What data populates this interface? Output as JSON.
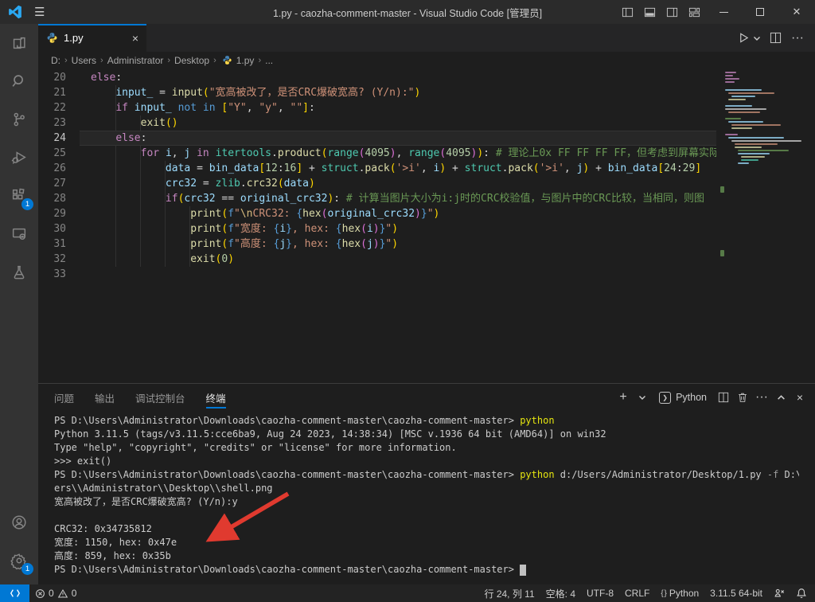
{
  "window": {
    "title": "1.py - caozha-comment-master - Visual Studio Code [管理员]"
  },
  "colors": {
    "accent": "#0078d4",
    "arrow": "#e03a2f",
    "terminal_command": "#e5e510"
  },
  "activity_bar": {
    "extensions_badge": "1",
    "settings_badge": "1"
  },
  "tab": {
    "label": "1.py",
    "close": "×"
  },
  "breadcrumb": {
    "items": [
      "D:",
      "Users",
      "Administrator",
      "Desktop",
      "1.py",
      "..."
    ]
  },
  "editor": {
    "lines": [
      {
        "no": "20",
        "segs": [
          [
            "else",
            "kw"
          ],
          [
            ":",
            "def"
          ]
        ]
      },
      {
        "no": "21",
        "segs": [
          [
            "    ",
            "ws"
          ],
          [
            "input_",
            "var"
          ],
          [
            " ",
            "ws"
          ],
          [
            "=",
            "op"
          ],
          [
            " ",
            "ws"
          ],
          [
            "input",
            "fn"
          ],
          [
            "(",
            "b1"
          ],
          [
            "\"宽高被改了，是否CRC爆破宽高? (Y/n):\"",
            "str"
          ],
          [
            ")",
            "b1"
          ]
        ]
      },
      {
        "no": "22",
        "segs": [
          [
            "    ",
            "ws"
          ],
          [
            "if",
            "kw"
          ],
          [
            " ",
            "ws"
          ],
          [
            "input_",
            "var"
          ],
          [
            " ",
            "ws"
          ],
          [
            "not",
            "kb"
          ],
          [
            " ",
            "ws"
          ],
          [
            "in",
            "kb"
          ],
          [
            " ",
            "ws"
          ],
          [
            "[",
            "b1"
          ],
          [
            "\"Y\"",
            "str"
          ],
          [
            ", ",
            "def"
          ],
          [
            "\"y\"",
            "str"
          ],
          [
            ", ",
            "def"
          ],
          [
            "\"\"",
            "str"
          ],
          [
            "]",
            "b1"
          ],
          [
            ":",
            "def"
          ]
        ]
      },
      {
        "no": "23",
        "segs": [
          [
            "        ",
            "ws"
          ],
          [
            "exit",
            "fn"
          ],
          [
            "(",
            "b1"
          ],
          [
            ")",
            "b1"
          ]
        ]
      },
      {
        "no": "24",
        "current": true,
        "segs": [
          [
            "    ",
            "ws"
          ],
          [
            "else",
            "kw"
          ],
          [
            ":",
            "def"
          ]
        ]
      },
      {
        "no": "25",
        "segs": [
          [
            "        ",
            "ws"
          ],
          [
            "for",
            "kw"
          ],
          [
            " ",
            "ws"
          ],
          [
            "i",
            "var"
          ],
          [
            ", ",
            "def"
          ],
          [
            "j",
            "var"
          ],
          [
            " ",
            "ws"
          ],
          [
            "in",
            "kw"
          ],
          [
            " ",
            "ws"
          ],
          [
            "itertools",
            "cls"
          ],
          [
            ".",
            "def"
          ],
          [
            "product",
            "fn"
          ],
          [
            "(",
            "b1"
          ],
          [
            "range",
            "cls"
          ],
          [
            "(",
            "b2"
          ],
          [
            "4095",
            "num"
          ],
          [
            ")",
            "b2"
          ],
          [
            ", ",
            "def"
          ],
          [
            "range",
            "cls"
          ],
          [
            "(",
            "b2"
          ],
          [
            "4095",
            "num"
          ],
          [
            ")",
            "b2"
          ],
          [
            ")",
            "b1"
          ],
          [
            ":",
            "def"
          ],
          [
            " ",
            "ws"
          ],
          [
            "# 理论上0x FF FF FF FF，但考虑到屏幕实际",
            "com"
          ]
        ]
      },
      {
        "no": "26",
        "segs": [
          [
            "            ",
            "ws"
          ],
          [
            "data",
            "var"
          ],
          [
            " ",
            "ws"
          ],
          [
            "=",
            "op"
          ],
          [
            " ",
            "ws"
          ],
          [
            "bin_data",
            "var"
          ],
          [
            "[",
            "b1"
          ],
          [
            "12",
            "num"
          ],
          [
            ":",
            "def"
          ],
          [
            "16",
            "num"
          ],
          [
            "]",
            "b1"
          ],
          [
            " ",
            "ws"
          ],
          [
            "+",
            "op"
          ],
          [
            " ",
            "ws"
          ],
          [
            "struct",
            "cls"
          ],
          [
            ".",
            "def"
          ],
          [
            "pack",
            "fn"
          ],
          [
            "(",
            "b1"
          ],
          [
            "'>i'",
            "str"
          ],
          [
            ", ",
            "def"
          ],
          [
            "i",
            "var"
          ],
          [
            ")",
            "b1"
          ],
          [
            " ",
            "ws"
          ],
          [
            "+",
            "op"
          ],
          [
            " ",
            "ws"
          ],
          [
            "struct",
            "cls"
          ],
          [
            ".",
            "def"
          ],
          [
            "pack",
            "fn"
          ],
          [
            "(",
            "b1"
          ],
          [
            "'>i'",
            "str"
          ],
          [
            ", ",
            "def"
          ],
          [
            "j",
            "var"
          ],
          [
            ")",
            "b1"
          ],
          [
            " ",
            "ws"
          ],
          [
            "+",
            "op"
          ],
          [
            " ",
            "ws"
          ],
          [
            "bin_data",
            "var"
          ],
          [
            "[",
            "b1"
          ],
          [
            "24",
            "num"
          ],
          [
            ":",
            "def"
          ],
          [
            "29",
            "num"
          ],
          [
            "]",
            "b1"
          ]
        ]
      },
      {
        "no": "27",
        "segs": [
          [
            "            ",
            "ws"
          ],
          [
            "crc32",
            "var"
          ],
          [
            " ",
            "ws"
          ],
          [
            "=",
            "op"
          ],
          [
            " ",
            "ws"
          ],
          [
            "zlib",
            "cls"
          ],
          [
            ".",
            "def"
          ],
          [
            "crc32",
            "fn"
          ],
          [
            "(",
            "b1"
          ],
          [
            "data",
            "var"
          ],
          [
            ")",
            "b1"
          ]
        ]
      },
      {
        "no": "28",
        "segs": [
          [
            "            ",
            "ws"
          ],
          [
            "if",
            "kw"
          ],
          [
            "(",
            "b1"
          ],
          [
            "crc32",
            "var"
          ],
          [
            " ",
            "ws"
          ],
          [
            "==",
            "op"
          ],
          [
            " ",
            "ws"
          ],
          [
            "original_crc32",
            "var"
          ],
          [
            ")",
            "b1"
          ],
          [
            ":",
            "def"
          ],
          [
            " ",
            "ws"
          ],
          [
            "# 计算当图片大小为i:j时的CRC校验值，与图片中的CRC比较，当相同，则图",
            "com"
          ]
        ]
      },
      {
        "no": "29",
        "segs": [
          [
            "                ",
            "ws"
          ],
          [
            "print",
            "fn"
          ],
          [
            "(",
            "b1"
          ],
          [
            "f",
            "kb"
          ],
          [
            "\"",
            "str"
          ],
          [
            "\\n",
            "esc"
          ],
          [
            "CRC32: ",
            "str"
          ],
          [
            "{",
            "kb"
          ],
          [
            "hex",
            "fn"
          ],
          [
            "(",
            "b2"
          ],
          [
            "original_crc32",
            "var"
          ],
          [
            ")",
            "b2"
          ],
          [
            "}",
            "kb"
          ],
          [
            "\"",
            "str"
          ],
          [
            ")",
            "b1"
          ]
        ]
      },
      {
        "no": "30",
        "segs": [
          [
            "                ",
            "ws"
          ],
          [
            "print",
            "fn"
          ],
          [
            "(",
            "b1"
          ],
          [
            "f",
            "kb"
          ],
          [
            "\"宽度: ",
            "str"
          ],
          [
            "{",
            "kb"
          ],
          [
            "i",
            "var"
          ],
          [
            "}",
            "kb"
          ],
          [
            ", hex: ",
            "str"
          ],
          [
            "{",
            "kb"
          ],
          [
            "hex",
            "fn"
          ],
          [
            "(",
            "b2"
          ],
          [
            "i",
            "var"
          ],
          [
            ")",
            "b2"
          ],
          [
            "}",
            "kb"
          ],
          [
            "\"",
            "str"
          ],
          [
            ")",
            "b1"
          ]
        ]
      },
      {
        "no": "31",
        "segs": [
          [
            "                ",
            "ws"
          ],
          [
            "print",
            "fn"
          ],
          [
            "(",
            "b1"
          ],
          [
            "f",
            "kb"
          ],
          [
            "\"高度: ",
            "str"
          ],
          [
            "{",
            "kb"
          ],
          [
            "j",
            "var"
          ],
          [
            "}",
            "kb"
          ],
          [
            ", hex: ",
            "str"
          ],
          [
            "{",
            "kb"
          ],
          [
            "hex",
            "fn"
          ],
          [
            "(",
            "b2"
          ],
          [
            "j",
            "var"
          ],
          [
            ")",
            "b2"
          ],
          [
            "}",
            "kb"
          ],
          [
            "\"",
            "str"
          ],
          [
            ")",
            "b1"
          ]
        ]
      },
      {
        "no": "32",
        "segs": [
          [
            "                ",
            "ws"
          ],
          [
            "exit",
            "fn"
          ],
          [
            "(",
            "b1"
          ],
          [
            "0",
            "num"
          ],
          [
            ")",
            "b1"
          ]
        ]
      },
      {
        "no": "33",
        "segs": []
      }
    ]
  },
  "panel": {
    "tabs": [
      {
        "label": "问题",
        "active": false
      },
      {
        "label": "输出",
        "active": false
      },
      {
        "label": "调试控制台",
        "active": false
      },
      {
        "label": "终端",
        "active": true
      }
    ],
    "terminal_profile": "Python"
  },
  "terminal": {
    "lines": [
      [
        [
          "PS D:\\Users\\Administrator\\Downloads\\caozha-comment-master\\caozha-comment-master> ",
          "t"
        ],
        [
          "python",
          "y"
        ]
      ],
      [
        [
          "Python 3.11.5 (tags/v3.11.5:cce6ba9, Aug 24 2023, 14:38:34) [MSC v.1936 64 bit (AMD64)] on win32",
          "t"
        ]
      ],
      [
        [
          "Type \"help\", \"copyright\", \"credits\" or \"license\" for more information.",
          "t"
        ]
      ],
      [
        [
          ">>> exit()",
          "t"
        ]
      ],
      [
        [
          "PS D:\\Users\\Administrator\\Downloads\\caozha-comment-master\\caozha-comment-master> ",
          "t"
        ],
        [
          "python",
          "y"
        ],
        [
          " d:/Users/Administrator/Desktop/1.py ",
          "t"
        ],
        [
          "-f",
          "g"
        ],
        [
          " D:\\\\Us",
          "t"
        ]
      ],
      [
        [
          "ers\\\\Administrator\\\\Desktop\\\\shell.png",
          "t"
        ]
      ],
      [
        [
          "宽高被改了，是否CRC爆破宽高? (Y/n):y",
          "t"
        ]
      ],
      [
        [
          "",
          "t"
        ]
      ],
      [
        [
          "CRC32: 0x34735812",
          "t"
        ]
      ],
      [
        [
          "宽度: 1150, hex: 0x47e",
          "t"
        ]
      ],
      [
        [
          "高度: 859, hex: 0x35b",
          "t"
        ]
      ],
      [
        [
          "PS D:\\Users\\Administrator\\Downloads\\caozha-comment-master\\caozha-comment-master> ",
          "t"
        ],
        [
          "",
          "cursor"
        ]
      ]
    ]
  },
  "status_bar": {
    "errors": "0",
    "warnings": "0",
    "cursor_position": "行 24, 列 11",
    "indentation": "空格: 4",
    "encoding": "UTF-8",
    "eol": "CRLF",
    "language_icon": "{ }",
    "language": "Python",
    "interpreter": "3.11.5 64-bit"
  }
}
